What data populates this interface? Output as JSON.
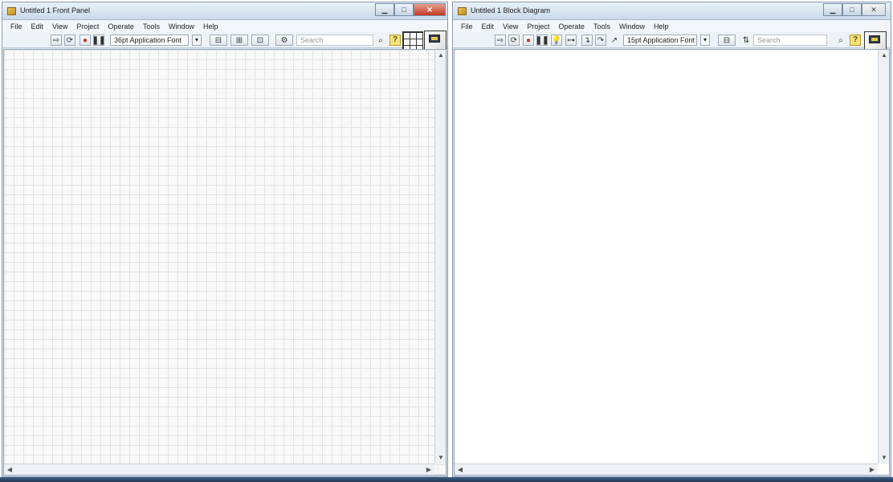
{
  "front_panel": {
    "title": "Untitled 1 Front Panel",
    "menu": [
      "File",
      "Edit",
      "View",
      "Project",
      "Operate",
      "Tools",
      "Window",
      "Help"
    ],
    "font_selector": "36pt Application Font",
    "search_placeholder": "Search",
    "help_label": "?"
  },
  "block_diagram": {
    "title": "Untitled 1 Block Diagram",
    "menu": [
      "File",
      "Edit",
      "View",
      "Project",
      "Operate",
      "Tools",
      "Window",
      "Help"
    ],
    "font_selector": "15pt Application Font",
    "search_placeholder": "Search",
    "help_label": "?"
  },
  "colors": {
    "titlebar": "#d6e2ee",
    "close_button": "#c23a22",
    "grid": "#e1e4e1",
    "help_button": "#f7e27a"
  }
}
